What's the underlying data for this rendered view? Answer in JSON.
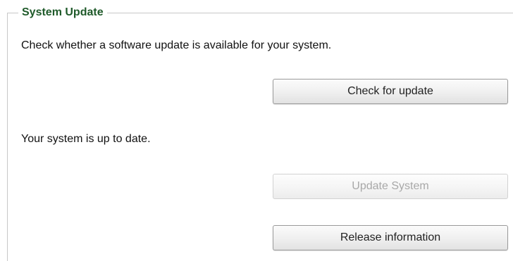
{
  "section": {
    "title": "System Update",
    "description": "Check whether a software update is available for your system.",
    "status": "Your system is up to date."
  },
  "buttons": {
    "check_update": {
      "label": "Check for update",
      "enabled": true
    },
    "update_system": {
      "label": "Update System",
      "enabled": false
    },
    "release_info": {
      "label": "Release information",
      "enabled": true
    }
  },
  "colors": {
    "legend_text": "#1f5a2a",
    "disabled_text": "#a8a8a8",
    "frame_border": "#c8c8c8"
  }
}
